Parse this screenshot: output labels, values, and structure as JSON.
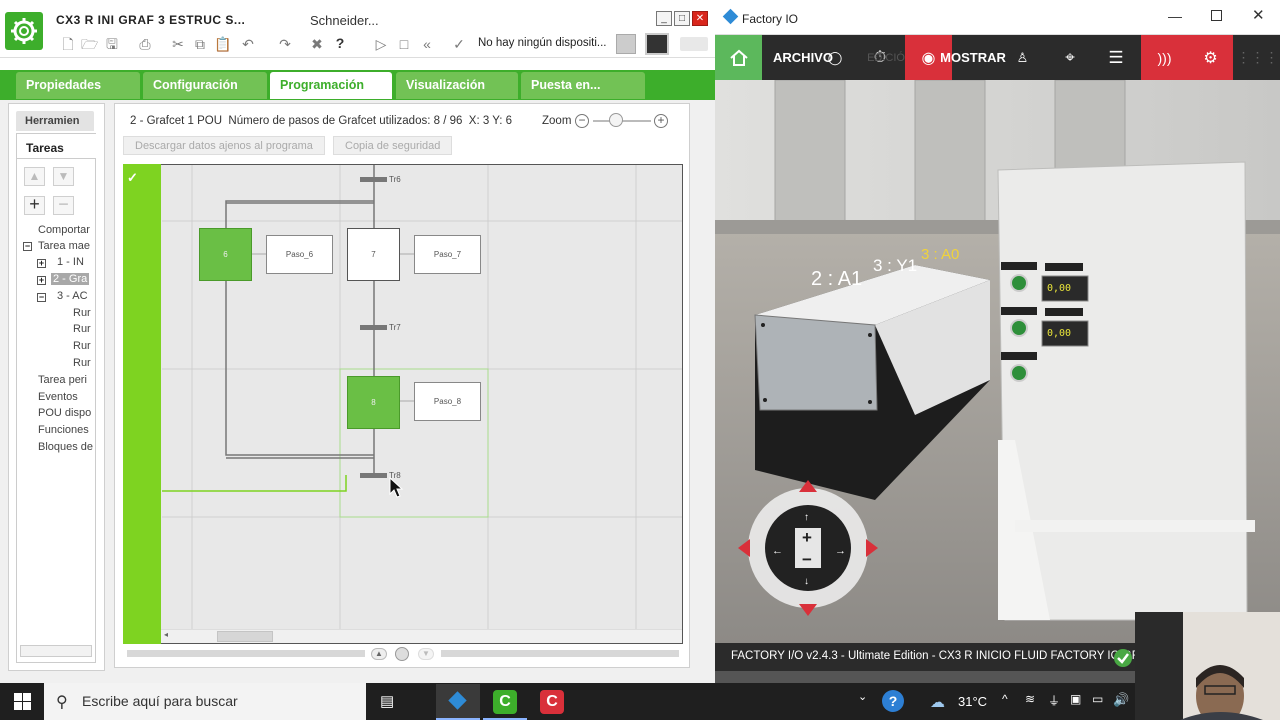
{
  "schneider": {
    "title": "CX3 R  INI  GRAF  3 ESTRUC   S...",
    "vendor": "Schneider...",
    "device_status": "No hay ningún dispositi...",
    "tabs": [
      "Propiedades",
      "Configuración",
      "Programación",
      "Visualización",
      "Puesta en..."
    ],
    "active_tab": "Programación",
    "left_tabs": {
      "tools": "Herramien",
      "tasks": "Tareas"
    },
    "tree": [
      "Comportar",
      "Tarea mae",
      "1 - IN",
      "2 - Gra",
      "3 - AC",
      "Rur",
      "Rur",
      "Rur",
      "Rur",
      "Tarea peri",
      "Eventos",
      "POU dispo",
      "Funciones",
      "Bloques de"
    ],
    "pou_title": "2 - Grafcet 1 POU",
    "steps_used_label": "Número de pasos de Grafcet utilizados:",
    "steps_used_value": "8 / 96",
    "coords": "X: 3  Y: 6",
    "zoom_label": "Zoom",
    "btn_download": "Descargar datos ajenos al programa",
    "btn_backup": "Copia de seguridad",
    "grafcet": {
      "transitions": [
        "Tr6",
        "Tr7",
        "Tr8"
      ],
      "steps": [
        {
          "num": "6",
          "label": "Paso_6",
          "active": true
        },
        {
          "num": "7",
          "label": "Paso_7",
          "active": false
        },
        {
          "num": "8",
          "label": "Paso_8",
          "active": true
        }
      ]
    }
  },
  "factory_io": {
    "title": "Factory IO",
    "toolbar": {
      "file": "ARCHIVO",
      "edit": "EDICIÓN",
      "show": "MOSTRAR"
    },
    "scene_labels": {
      "a1": "2 : A1",
      "y1": "3 : Y1",
      "a0": "3 : A0"
    },
    "displays": [
      "0,00",
      "0,00"
    ],
    "status": "FACTORY I/O v2.4.3 - Ultimate Edition - CX3 R INICIO  FLUID  FACTORY IO  GR..."
  },
  "taskbar": {
    "search_placeholder": "Escribe aquí para buscar",
    "temperature": "31°C"
  },
  "colors": {
    "schneider_green": "#3dae2b",
    "step_active": "#6abf45",
    "fio_red": "#d9303a"
  }
}
